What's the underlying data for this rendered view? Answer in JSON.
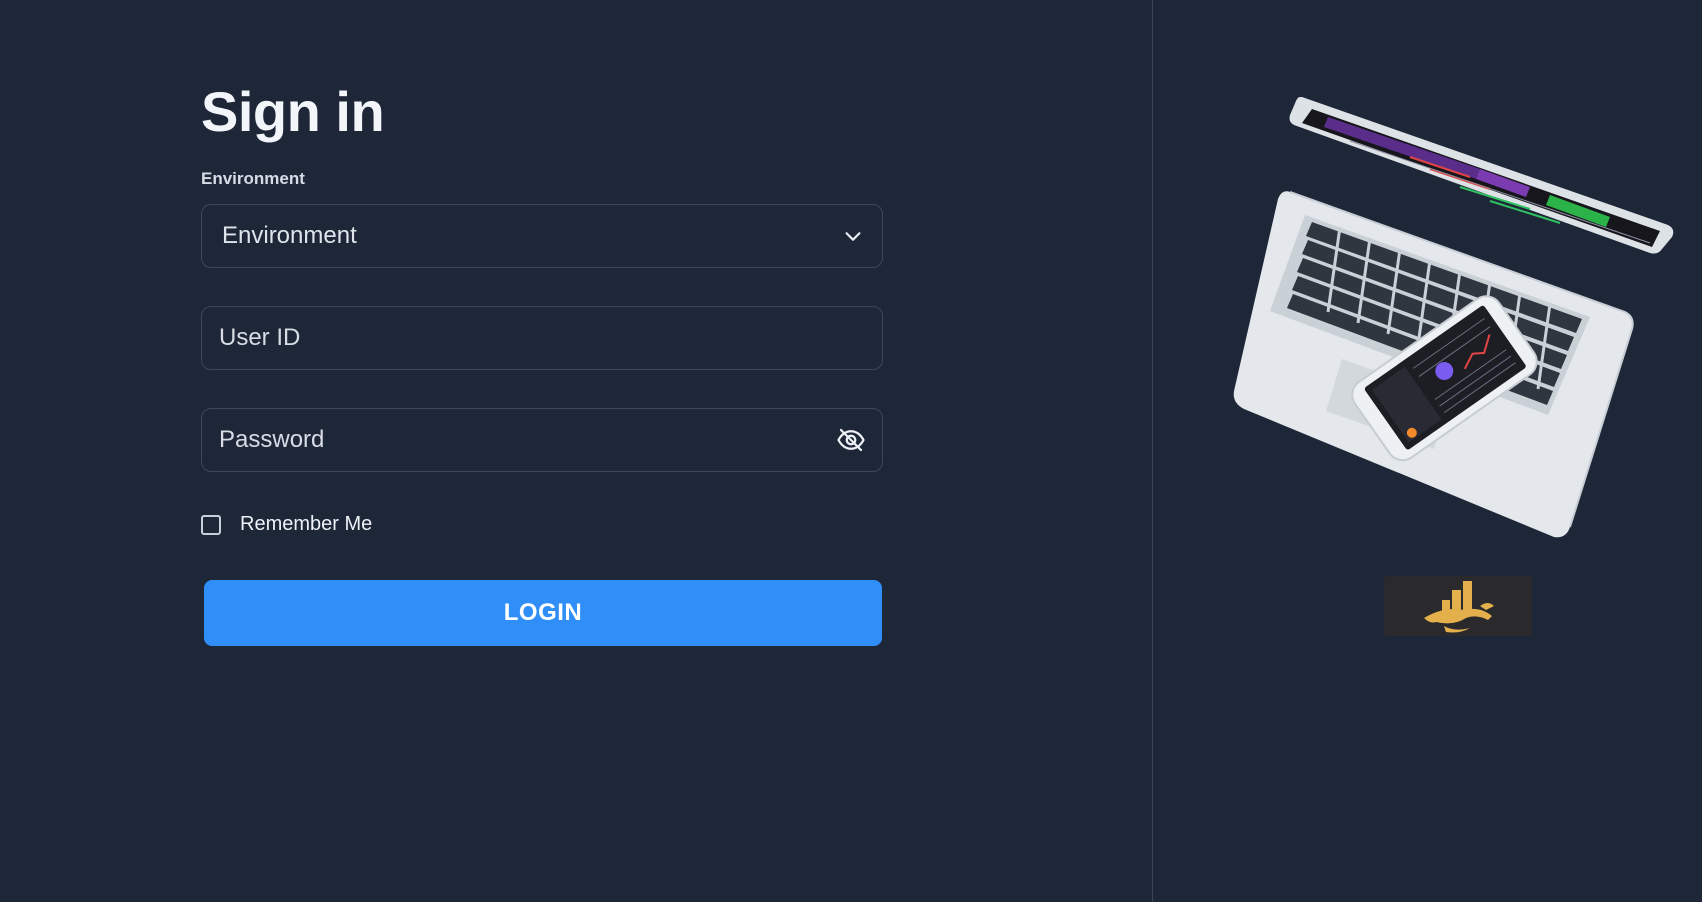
{
  "page": {
    "title": "Sign in"
  },
  "environment": {
    "label": "Environment",
    "selected": "Environment"
  },
  "user_id": {
    "placeholder": "User ID",
    "value": ""
  },
  "password": {
    "placeholder": "Password",
    "value": ""
  },
  "remember_me": {
    "label": "Remember Me",
    "checked": false
  },
  "login": {
    "label": "LOGIN"
  },
  "icons": {
    "environment_dropdown": "chevron-down-icon",
    "password_visibility": "eye-off-icon"
  },
  "colors": {
    "background": "#1e2738",
    "primary_button": "#2f8ef7",
    "divider": "#3a4558",
    "logo_gold": "#e3b04b"
  }
}
